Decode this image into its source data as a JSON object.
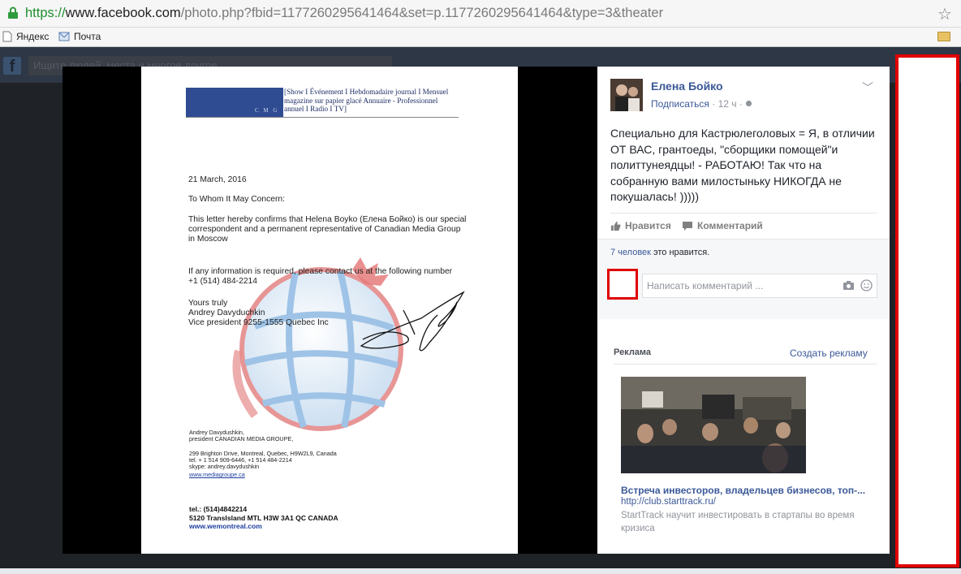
{
  "browser": {
    "url_scheme": "https://",
    "url_domain": "www.facebook.com",
    "url_path": "/photo.php?fbid=1177260295641464&set=p.1177260295641464&type=3&theater",
    "bookmarks": [
      {
        "label": "Яндекс",
        "icon": "page-icon"
      },
      {
        "label": "Почта",
        "icon": "mail-icon"
      }
    ]
  },
  "facebook": {
    "search_placeholder": "Ищите людей, места и многое другое"
  },
  "letter": {
    "letterhead_text": "[Show I Événement I Hebdomadaire journal I Mensuel magazine sur papier glacé  Annuaire - Professionnel annuel I Radio I TV]",
    "letterhead_logo": "C M G",
    "date": "21 March, 2016",
    "salutation": "To Whom It May Concern:",
    "para1": "This letter hereby confirms that Helena Boyko (Елена Бойко) is our special correspondent and  a permanent representative of Canadian Media Group in Moscow",
    "para2": "If any information is required, please contact us at the following number +1 (514) 484-2214",
    "closing": "Yours truly",
    "signer": "Andrey Davyduchkin",
    "signer_title": "Vice president 9255-1555 Quebec Inc",
    "footer_name": "Andrey Davydushkin,",
    "footer_role": "president CANADIAN MEDIA GROUPE,",
    "footer_addr": "299 Brighton Drive,  Montreal, Quebec, H9W2L9, Canada",
    "footer_tel": "tel. + 1 514 909-6446, +1 514 484-2214",
    "footer_skype": "skype: andrey.davydushkin",
    "footer_web": "www.mediagroupe.ca",
    "bottom_tel": "tel.: (514)4842214",
    "bottom_addr": "5120 TransIsland MTL H3W 3A1 QC CANADA",
    "bottom_web": "www.wemontreal.com"
  },
  "post": {
    "author": "Елена Бойко",
    "follow": "Подписаться",
    "time": " · 12 ч · ",
    "text": "Специально для Кастрюлеголовых = Я, в отличии ОТ ВАС, грантоеды, \"сборщики помощей\"и политтунеядцы! - РАБОТАЮ! Так что на собранную вами милостыньку НИКОГДА не покушалась! )))))",
    "like_label": "Нравится",
    "comment_label": "Комментарий",
    "likes_count": "7 человек",
    "likes_suffix": " это нравится.",
    "comment_placeholder": "Написать комментарий ..."
  },
  "ad": {
    "header": "Реклама",
    "create": "Создать рекламу",
    "title": "Встреча инвесторов, владельцев бизнесов, топ-...",
    "url": "http://club.starttrack.ru/",
    "desc": "StartTrack научит инвестировать в стартапы во время кризиса"
  },
  "colors": {
    "fb_blue": "#3b5998",
    "highlight_red": "#e00000",
    "url_green": "#1e8f2e"
  }
}
